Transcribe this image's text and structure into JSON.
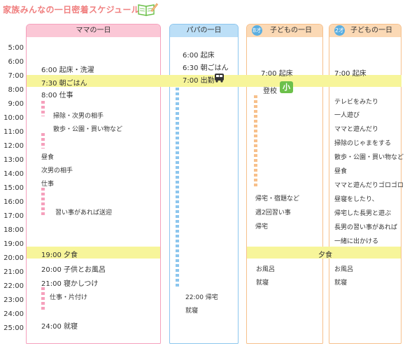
{
  "title": "家族みんなの一日密着スケジュール",
  "columns": {
    "mama": "ママの一日",
    "papa": "パパの一日",
    "child8": {
      "age": "8才",
      "label": "子どもの一日"
    },
    "child2": {
      "age": "2才",
      "label": "子どもの一日"
    }
  },
  "hours": [
    "5:00",
    "6:00",
    "7:00",
    "8:00",
    "9:00",
    "10:00",
    "11:00",
    "12:00",
    "13:00",
    "14:00",
    "15:00",
    "16:00",
    "17:00",
    "18:00",
    "19:00",
    "20:00",
    "21:00",
    "22:00",
    "23:00",
    "24:00",
    "25:00"
  ],
  "mama": {
    "e1": "6:00 起床・洗濯",
    "e2": "7:30 朝ごはん",
    "e3": "8:00 仕事",
    "e4": "掃除・次男の相手",
    "e5": "散歩・公園・買い物など",
    "e6": "昼食",
    "e7": "次男の相手",
    "e8": "仕事",
    "e9": "習い事があれば送迎",
    "e10": "19:00 夕食",
    "e11": "20:00 子供とお風呂",
    "e12": "21:00 寝かしつけ",
    "e13": "仕事・片付け",
    "e14": "24:00 就寝"
  },
  "papa": {
    "e1": "6:00 起床",
    "e2": "6:30 朝ごはん",
    "e3": "7:00 出勤",
    "e4": "22:00 帰宅",
    "e5": "就寝"
  },
  "child8": {
    "e1": "7:00 起床",
    "e2": "登校",
    "school_badge": "小",
    "e3": "帰宅・宿題など",
    "e4": "週2回習い事",
    "e5": "帰宅",
    "e6": "お風呂",
    "e7": "就寝"
  },
  "shared_dinner": "夕食",
  "child2": {
    "e1": "7:00 起床",
    "e2": "テレビをみたり",
    "e3": "一人遊び",
    "e4": "ママと遊んだり",
    "e5": "掃除のじゃまをする",
    "e6": "散歩・公園・買い物など",
    "e7": "昼食",
    "e8": "ママと遊んだりゴロゴロ",
    "e9": "昼寝をしたり、",
    "e10": "帰宅した長男と遊ぶ",
    "e11": "長男の習い事があれば",
    "e12": "一緒に出かける",
    "e13": "お風呂",
    "e14": "就寝"
  },
  "colors": {
    "title": "#f08080",
    "mama": "#f5a0bc",
    "papa": "#8cc6ee",
    "child": "#f7c08b",
    "highlight": "#f7f59a",
    "school_badge": "#6cc04a"
  },
  "icons": [
    "book-pencil-icon",
    "bus-icon",
    "heart-age-icon"
  ]
}
